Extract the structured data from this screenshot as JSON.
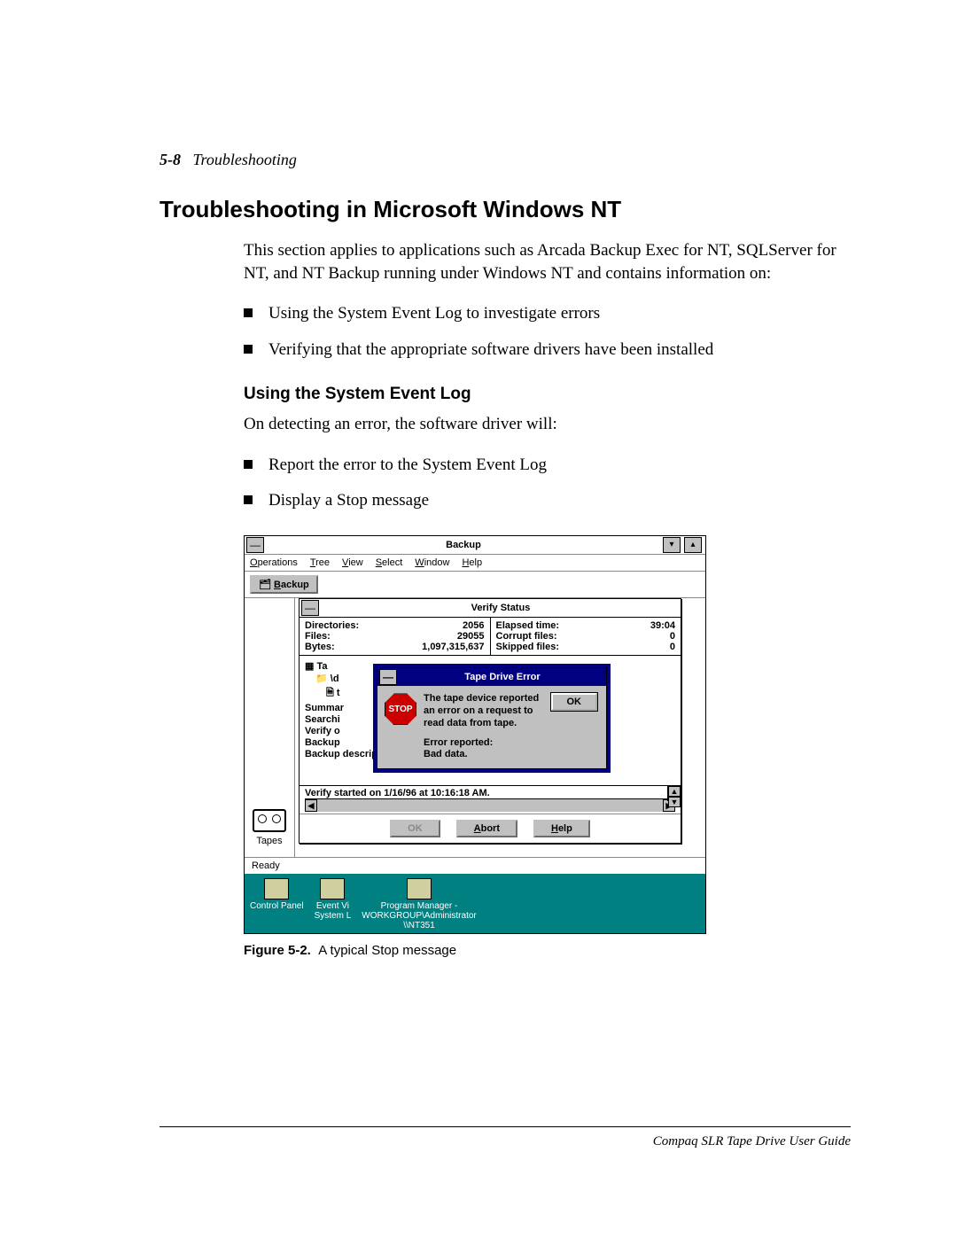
{
  "header": {
    "page_number": "5-8",
    "section": "Troubleshooting"
  },
  "h1": "Troubleshooting in Microsoft Windows NT",
  "intro": "This section applies to applications such as Arcada Backup Exec for NT, SQLServer for NT, and NT Backup running under Windows NT and contains information on:",
  "bullets_a": [
    "Using the System Event Log to investigate errors",
    "Verifying that the appropriate software drivers have been installed"
  ],
  "h2": "Using the System Event Log",
  "p2": "On detecting an error, the software driver will:",
  "bullets_b": [
    "Report the error to the System Event Log",
    "Display a Stop message"
  ],
  "shot": {
    "app_title": "Backup",
    "menus": [
      "Operations",
      "Tree",
      "View",
      "Select",
      "Window",
      "Help"
    ],
    "tab_label": "Backup",
    "tapes_label": "Tapes",
    "verify": {
      "title": "Verify Status",
      "left": {
        "Directories:": "2056",
        "Files:": "29055",
        "Bytes:": "1,097,315,637"
      },
      "right": {
        "Elapsed time:": "39:04",
        "Corrupt files:": "0",
        "Skipped files:": "0"
      },
      "tree_lines": [
        "Ta",
        "\\d",
        "t",
        "Summar",
        "Searchi",
        "",
        "Verify o",
        "Backup",
        "Backup description:"
      ],
      "log_line": "Verify started on 1/16/96 at 10:16:18 AM.",
      "buttons": {
        "ok": "OK",
        "abort": "Abort",
        "help": "Help"
      }
    },
    "error": {
      "title": "Tape Drive Error",
      "stop": "STOP",
      "msg1": "The tape device reported an error on a request to read data from tape.",
      "msg2": "Error reported:",
      "msg3": "Bad data.",
      "ok": "OK"
    },
    "status": "Ready",
    "desktop": {
      "i1": "Control Panel",
      "i2": "Event Vi",
      "i2b": "System L",
      "i3a": "Program Manager -",
      "i3b": "WORKGROUP\\Administrator",
      "i3c": "\\\\NT351"
    }
  },
  "caption_label": "Figure 5-2.",
  "caption_text": "A typical Stop message",
  "footer": "Compaq SLR Tape Drive User Guide"
}
